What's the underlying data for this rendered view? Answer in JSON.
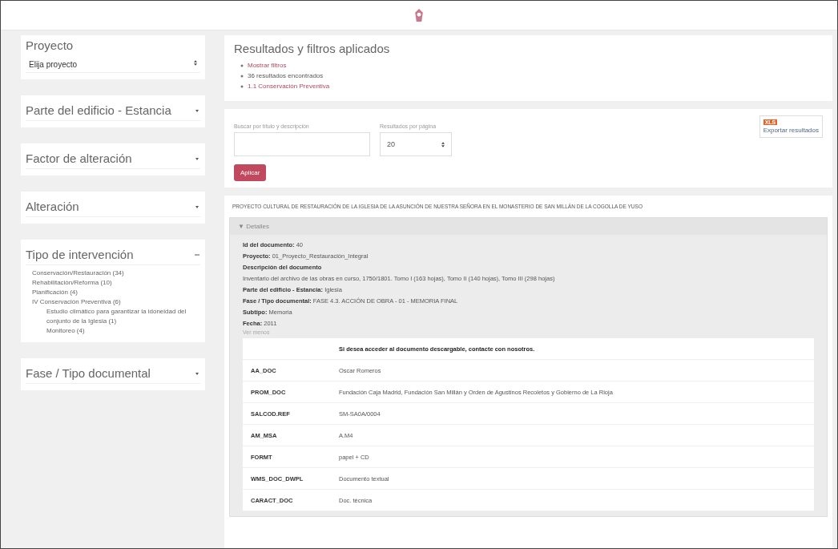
{
  "sidebar": {
    "project": {
      "title": "Proyecto",
      "select": "Elija proyecto"
    },
    "filters": [
      {
        "title": "Parte del edificio - Estancia",
        "expanded": false
      },
      {
        "title": "Factor de alteración",
        "expanded": false
      },
      {
        "title": "Alteración",
        "expanded": false
      },
      {
        "title": "Tipo de intervención",
        "expanded": true,
        "items": [
          {
            "label": "Conservación/Restauración (34)"
          },
          {
            "label": "Rehabilitación/Reforma (10)"
          },
          {
            "label": "Planificación (4)"
          },
          {
            "label": "IV Conservación Preventiva (6)",
            "children": [
              {
                "label": "Estudio climático para garantizar la idoneidad del conjunto de la Iglesia (1)"
              },
              {
                "label": "Monitoreo (4)"
              }
            ]
          }
        ]
      },
      {
        "title": "Fase / Tipo documental",
        "expanded": false
      }
    ]
  },
  "results": {
    "title": "Resultados y filtros aplicados",
    "items": [
      {
        "text": "Mostrar filtros",
        "kind": "link"
      },
      {
        "text": "36 resultados encontrados",
        "kind": "text"
      },
      {
        "text": "1.1 Conservación Preventiva",
        "kind": "link"
      }
    ]
  },
  "search": {
    "label": "Buscar por título y descripción",
    "per_page_label": "Resultados por página",
    "per_page": "20",
    "apply": "Aplicar",
    "export_badge": "XLS",
    "export": "Exportar resultados"
  },
  "document": {
    "title": "PROYECTO CULTURAL DE RESTAURACIÓN DE LA IGLESIA DE LA ASUNCIÓN DE NUESTRA SEÑORA EN EL MONASTERIO DE SAN MILLÁN DE LA COGOLLA DE YUSO",
    "details_toggle": "▼ Detalles",
    "expanded": true,
    "fields": [
      {
        "label": "Id del documento:",
        "value": "40"
      },
      {
        "label": "Proyecto:",
        "value": "01_Proyecto_Restauración_Integral"
      },
      {
        "label": "Descripción del documento"
      },
      {
        "value": "Inventario del archivo de las obras en curso, 1750/1801. Tomo I (163 hojas), Tomo II (140 hojas), Tomo III (298 hojas)"
      },
      {
        "label": "Parte del edificio - Estancia:",
        "value": "Iglesia"
      },
      {
        "label": "Fase / Tipo documental:",
        "value": "FASE 4.3. ACCIÓN DE OBRA - 01 - MEMORIA FINAL"
      },
      {
        "label": "Subtipo:",
        "value": "Memoria"
      },
      {
        "label": "Fecha:",
        "value": "2011"
      }
    ],
    "less": "Ver menos",
    "table_note": "Si desea acceder al documento descargable, contacte con nosotros.",
    "rows": [
      {
        "key": "AA_DOC",
        "value": "Oscar Romeros"
      },
      {
        "key": "PROM_DOC",
        "value": "Fundación Caja Madrid, Fundación San Millán y Orden de Agustinos Recoletos y Gobierno de La Rioja"
      },
      {
        "key": "SALCOD.REF",
        "value": "SM-SA0A/0004"
      },
      {
        "key": "AM_MSA",
        "value": "A.M4"
      },
      {
        "key": "FORMT",
        "value": "papel + CD"
      },
      {
        "key": "WMS_DOC_DWPL",
        "value": "Documento textual"
      },
      {
        "key": "CARACT_DOC",
        "value": "Doc. técnica"
      }
    ]
  }
}
